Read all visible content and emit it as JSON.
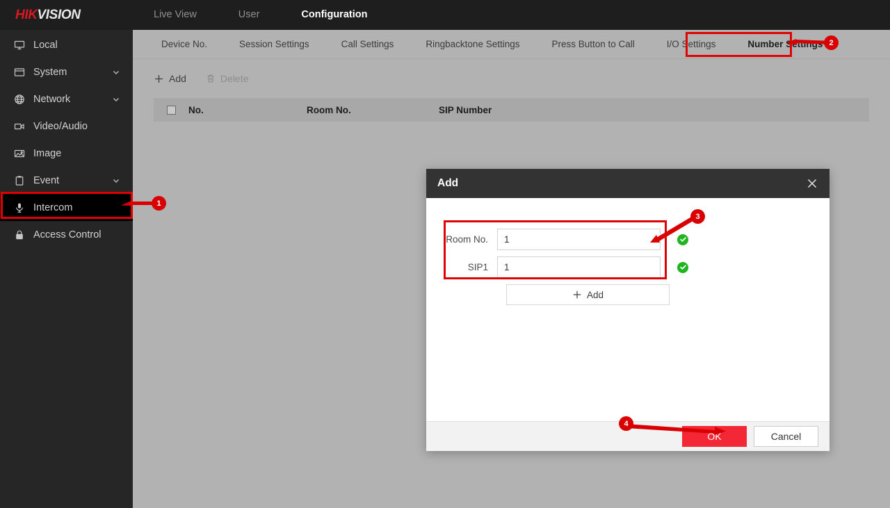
{
  "brand": {
    "part1": "HIK",
    "part2": "VISION"
  },
  "topnav": {
    "items": [
      {
        "label": "Live View",
        "active": false
      },
      {
        "label": "User",
        "active": false
      },
      {
        "label": "Configuration",
        "active": true
      }
    ]
  },
  "sidebar": {
    "items": [
      {
        "label": "Local",
        "icon": "monitor-icon",
        "expandable": false,
        "selected": false
      },
      {
        "label": "System",
        "icon": "window-icon",
        "expandable": true,
        "selected": false
      },
      {
        "label": "Network",
        "icon": "globe-icon",
        "expandable": true,
        "selected": false
      },
      {
        "label": "Video/Audio",
        "icon": "video-icon",
        "expandable": false,
        "selected": false
      },
      {
        "label": "Image",
        "icon": "picture-icon",
        "expandable": false,
        "selected": false
      },
      {
        "label": "Event",
        "icon": "clipboard-icon",
        "expandable": true,
        "selected": false
      },
      {
        "label": "Intercom",
        "icon": "microphone-icon",
        "expandable": false,
        "selected": true
      },
      {
        "label": "Access Control",
        "icon": "lock-icon",
        "expandable": false,
        "selected": false
      }
    ]
  },
  "tabs": {
    "items": [
      {
        "label": "Device No.",
        "active": false
      },
      {
        "label": "Session Settings",
        "active": false
      },
      {
        "label": "Call Settings",
        "active": false
      },
      {
        "label": "Ringbacktone Settings",
        "active": false
      },
      {
        "label": "Press Button to Call",
        "active": false
      },
      {
        "label": "I/O Settings",
        "active": false
      },
      {
        "label": "Number Settings",
        "active": true
      }
    ]
  },
  "toolbar": {
    "add_label": "Add",
    "delete_label": "Delete"
  },
  "table": {
    "columns": [
      "No.",
      "Room No.",
      "SIP Number"
    ],
    "rows": []
  },
  "dialog": {
    "title": "Add",
    "close_label": "×",
    "fields": [
      {
        "label": "Room No.",
        "value": "1",
        "valid": true
      },
      {
        "label": "SIP1",
        "value": "1",
        "valid": true
      }
    ],
    "add_row_label": "Add",
    "ok_label": "OK",
    "cancel_label": "Cancel"
  },
  "annotations": {
    "markers": [
      {
        "id": "1",
        "target": "sidebar-item-intercom"
      },
      {
        "id": "2",
        "target": "tab-number-settings"
      },
      {
        "id": "3",
        "target": "dialog-fields-group"
      },
      {
        "id": "4",
        "target": "dialog-ok-button"
      }
    ],
    "color": "#d80000"
  }
}
